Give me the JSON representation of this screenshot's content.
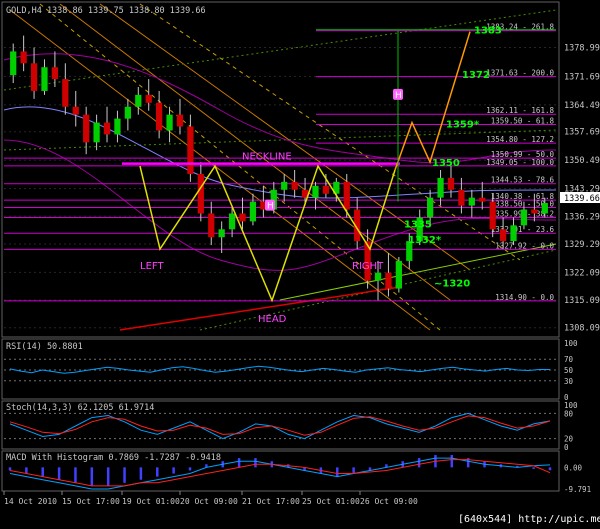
{
  "chart_data": [
    {
      "type": "candlestick",
      "panel": "price",
      "header": "GOLD,H4  1338.86 1339.75 1338.80 1339.66",
      "current_price": "1339.66",
      "ylim": [
        1306,
        1390
      ],
      "y_ticks": [
        "1378.99",
        "1371.69",
        "1364.49",
        "1357.69",
        "1350.49",
        "1343.29",
        "1336.29",
        "1329.29",
        "1322.09",
        "1315.09",
        "1308.09"
      ],
      "x_ticks": [
        "14 Oct 2010",
        "15 Oct 17:00",
        "19 Oct 01:00",
        "20 Oct 09:00",
        "21 Oct 17:00",
        "25 Oct 01:00",
        "26 Oct 09:00"
      ],
      "fib_levels": [
        {
          "label": "1383.24 - 261.8",
          "value": 1383.24
        },
        {
          "label": "1371.63 - 200.0",
          "value": 1371.63
        },
        {
          "label": "1362.11 - 161.8",
          "value": 1362.11
        },
        {
          "label": "1359.50 - 61.8",
          "value": 1359.5
        },
        {
          "label": "1354.80 - 127.2",
          "value": 1354.8
        },
        {
          "label": "1350.99 - 50.0",
          "value": 1350.99
        },
        {
          "label": "1349.05 - 100.0",
          "value": 1349.05
        },
        {
          "label": "1344.53 - 78.6",
          "value": 1344.53
        },
        {
          "label": "1340.38 - 61.8",
          "value": 1340.38
        },
        {
          "label": "1338.50 - 50.0",
          "value": 1338.5
        },
        {
          "label": "1335.99 - 38.2",
          "value": 1335.99
        },
        {
          "label": "1332.01 - 23.6",
          "value": 1332.01
        },
        {
          "label": "1327.92 - 0.0",
          "value": 1327.92
        },
        {
          "label": "1314.90 - 0.0",
          "value": 1314.9
        }
      ],
      "targets": [
        {
          "label": "1383",
          "value": 1383.5
        },
        {
          "label": "1372",
          "value": 1372.3
        },
        {
          "label": "1359*",
          "value": 1359.8
        },
        {
          "label": "1350",
          "value": 1350.0
        },
        {
          "label": "1335",
          "value": 1334.5
        },
        {
          "label": "1332*",
          "value": 1330.5
        },
        {
          "label": "~1320",
          "value": 1319.5
        }
      ],
      "pattern_labels": {
        "neckline": "NECKLINE",
        "left": "LEFT",
        "head": "HEAD",
        "right": "RIGHT",
        "marker": "H"
      },
      "candles": [
        [
          1372,
          1380,
          1370,
          1378
        ],
        [
          1378,
          1382,
          1373,
          1375
        ],
        [
          1375,
          1379,
          1366,
          1368
        ],
        [
          1368,
          1376,
          1367,
          1374
        ],
        [
          1374,
          1378,
          1369,
          1371
        ],
        [
          1371,
          1375,
          1362,
          1364
        ],
        [
          1364,
          1368,
          1359,
          1362
        ],
        [
          1362,
          1364,
          1352,
          1355
        ],
        [
          1355,
          1362,
          1353,
          1360
        ],
        [
          1360,
          1364,
          1355,
          1357
        ],
        [
          1357,
          1363,
          1355,
          1361
        ],
        [
          1361,
          1366,
          1358,
          1364
        ],
        [
          1364,
          1369,
          1362,
          1367
        ],
        [
          1367,
          1371,
          1363,
          1365
        ],
        [
          1365,
          1368,
          1356,
          1358
        ],
        [
          1358,
          1364,
          1355,
          1362
        ],
        [
          1362,
          1366,
          1357,
          1359
        ],
        [
          1359,
          1362,
          1345,
          1347
        ],
        [
          1347,
          1350,
          1335,
          1337
        ],
        [
          1337,
          1340,
          1329,
          1331
        ],
        [
          1331,
          1335,
          1327,
          1333
        ],
        [
          1333,
          1339,
          1331,
          1337
        ],
        [
          1337,
          1341,
          1333,
          1335
        ],
        [
          1335,
          1342,
          1334,
          1340
        ],
        [
          1340,
          1344,
          1336,
          1338
        ],
        [
          1338,
          1345,
          1337,
          1343
        ],
        [
          1343,
          1347,
          1340,
          1345
        ],
        [
          1345,
          1348,
          1341,
          1343
        ],
        [
          1343,
          1346,
          1339,
          1341
        ],
        [
          1341,
          1345,
          1338,
          1344
        ],
        [
          1344,
          1347,
          1341,
          1342
        ],
        [
          1342,
          1346,
          1340,
          1345
        ],
        [
          1345,
          1347,
          1336,
          1338
        ],
        [
          1338,
          1341,
          1328,
          1330
        ],
        [
          1330,
          1333,
          1318,
          1320
        ],
        [
          1320,
          1325,
          1315,
          1322
        ],
        [
          1322,
          1327,
          1316,
          1318
        ],
        [
          1318,
          1326,
          1317,
          1325
        ],
        [
          1325,
          1332,
          1323,
          1330
        ],
        [
          1330,
          1338,
          1329,
          1336
        ],
        [
          1336,
          1343,
          1334,
          1341
        ],
        [
          1341,
          1348,
          1339,
          1346
        ],
        [
          1346,
          1349,
          1341,
          1343
        ],
        [
          1343,
          1346,
          1337,
          1339
        ],
        [
          1339,
          1343,
          1336,
          1341
        ],
        [
          1341,
          1345,
          1338,
          1340
        ],
        [
          1340,
          1342,
          1331,
          1333
        ],
        [
          1333,
          1336,
          1328,
          1330
        ],
        [
          1330,
          1336,
          1329,
          1334
        ],
        [
          1334,
          1340,
          1333,
          1338
        ],
        [
          1338,
          1342,
          1335,
          1337
        ],
        [
          1337,
          1341,
          1336,
          1339.66
        ]
      ],
      "candle_colors": {
        "up": "#00d000",
        "down": "#d00000",
        "wick": "#c8c8c8"
      }
    },
    {
      "type": "line",
      "panel": "rsi",
      "header": "RSI(14) 50.8801",
      "ylim": [
        0,
        100
      ],
      "y_ticks": [
        "100",
        "70",
        "50",
        "30",
        "0"
      ],
      "series": [
        {
          "color": "#00a0ff",
          "values": [
            52,
            48,
            45,
            50,
            47,
            44,
            46,
            49,
            52,
            55,
            53,
            50,
            48,
            46,
            50,
            54,
            56,
            53,
            49,
            46,
            48,
            51,
            54,
            57,
            55,
            52,
            49,
            47,
            50,
            53,
            51,
            48,
            46,
            50,
            52,
            54,
            51,
            49,
            47,
            50,
            53,
            55,
            52,
            50,
            48,
            51,
            53,
            50,
            49,
            51,
            50.88
          ]
        }
      ],
      "levels": [
        70,
        50,
        30
      ]
    },
    {
      "type": "line",
      "panel": "stochastic",
      "header": "Stoch(14,3,3) 62.1205 61.9714",
      "ylim": [
        0,
        100
      ],
      "y_ticks": [
        "100",
        "80",
        "20",
        "0"
      ],
      "series": [
        {
          "color": "#00a0ff",
          "values": [
            55,
            40,
            25,
            30,
            50,
            70,
            75,
            60,
            40,
            30,
            45,
            60,
            40,
            20,
            35,
            55,
            50,
            30,
            20,
            40,
            60,
            75,
            70,
            55,
            45,
            35,
            50,
            70,
            80,
            65,
            50,
            40,
            55,
            62.12
          ]
        },
        {
          "color": "#ff2020",
          "values": [
            60,
            48,
            35,
            32,
            42,
            60,
            70,
            66,
            50,
            38,
            40,
            52,
            45,
            30,
            32,
            46,
            50,
            40,
            28,
            35,
            52,
            68,
            72,
            62,
            50,
            40,
            45,
            60,
            74,
            70,
            57,
            45,
            50,
            61.97
          ]
        }
      ],
      "levels": [
        80,
        20
      ]
    },
    {
      "type": "bar",
      "panel": "macd",
      "header": "MACD With Histogram 0.7869 -1.7287 -0.9418",
      "y_ticks": [
        "0.00",
        "-9.791"
      ],
      "series": [
        {
          "name": "histogram",
          "color": "#4040ff",
          "values": [
            -1,
            -2,
            -3,
            -4,
            -5,
            -6,
            -6,
            -5,
            -4,
            -3,
            -2,
            -1,
            1,
            2,
            3,
            3,
            2,
            1,
            -1,
            -2,
            -3,
            -2,
            -1,
            1,
            2,
            3,
            4,
            4,
            3,
            2,
            1,
            0.5,
            -0.5,
            -0.94
          ]
        },
        {
          "name": "macd",
          "color": "#00a0ff",
          "values": [
            -2,
            -3,
            -4,
            -5,
            -6,
            -7,
            -7,
            -6,
            -5,
            -4,
            -3,
            -2,
            0,
            1,
            2,
            2,
            1,
            0,
            -1,
            -2,
            -3,
            -2,
            -1,
            0,
            1,
            2,
            3,
            3,
            2,
            1,
            0.5,
            0,
            0.5,
            0.79
          ]
        },
        {
          "name": "signal",
          "color": "#ff2020",
          "values": [
            -1,
            -2,
            -3,
            -4,
            -5,
            -6,
            -6,
            -6,
            -5,
            -5,
            -4,
            -3,
            -2,
            -1,
            0,
            1,
            1,
            0.5,
            0,
            -1,
            -2,
            -2,
            -1.5,
            -1,
            0,
            1,
            2,
            2.5,
            2.5,
            2,
            1.5,
            1,
            0.5,
            -1.73
          ]
        }
      ]
    }
  ],
  "footer": {
    "screen_info": "[640x544] http://upic.me/"
  },
  "colors": {
    "background": "#000000",
    "grid": "#2a2a2a",
    "text": "#c8c8c8",
    "fib": "#d000d0",
    "neckline": "#ff00ff",
    "target": "#00ff00",
    "projection": "#ff9a00",
    "pattern_label": "#ff40ff"
  }
}
